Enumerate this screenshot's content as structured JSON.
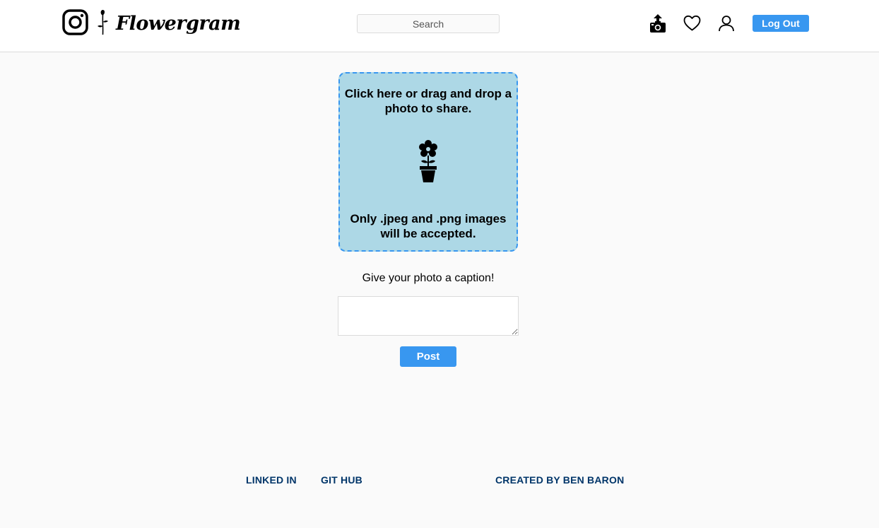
{
  "header": {
    "brand": "Flowergram",
    "search_placeholder": "Search",
    "logout_label": "Log Out",
    "icons": [
      "instagram-icon",
      "rose-icon",
      "upload-photo-icon",
      "heart-icon",
      "user-icon"
    ]
  },
  "upload": {
    "instruction": "Click here or drag and drop a photo to share.",
    "accepted_formats": "Only .jpeg and .png images will be accepted.",
    "icon": "flower-pot-icon"
  },
  "caption": {
    "label": "Give your photo a caption!",
    "value": "",
    "post_label": "Post"
  },
  "footer": {
    "linkedin": "LINKED IN",
    "github": "GIT HUB",
    "credit": "CREATED BY BEN BARON"
  },
  "colors": {
    "accent": "#3897f0",
    "dropzone_bg": "#add8e6",
    "footer_link": "#003569",
    "page_bg": "#fafafa"
  }
}
